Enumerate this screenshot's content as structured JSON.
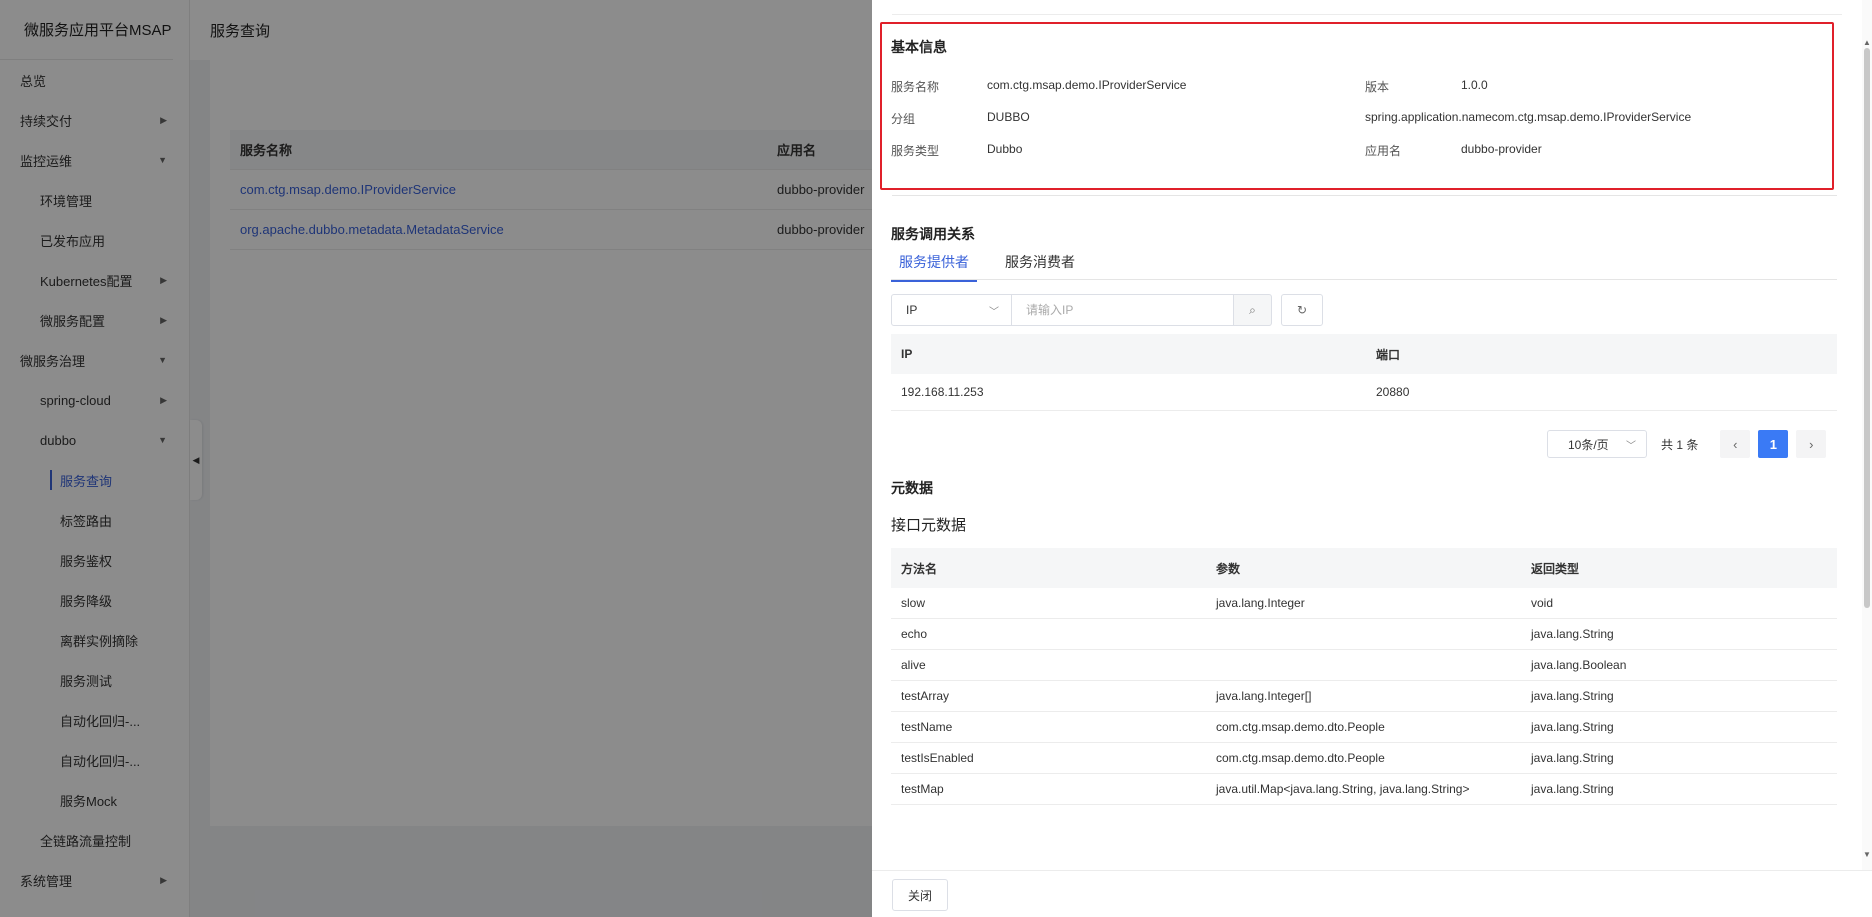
{
  "sidebar": {
    "title": "微服务应用平台MSAP",
    "items": [
      {
        "label": "总览",
        "level": 1,
        "arrow": ""
      },
      {
        "label": "持续交付",
        "level": 1,
        "arrow": "▶"
      },
      {
        "label": "监控运维",
        "level": 1,
        "arrow": "▼"
      },
      {
        "label": "环境管理",
        "level": 2,
        "arrow": ""
      },
      {
        "label": "已发布应用",
        "level": 2,
        "arrow": ""
      },
      {
        "label": "Kubernetes配置",
        "level": 2,
        "arrow": "▶"
      },
      {
        "label": "微服务配置",
        "level": 2,
        "arrow": "▶"
      },
      {
        "label": "微服务治理",
        "level": 1,
        "arrow": "▼"
      },
      {
        "label": "spring-cloud",
        "level": 2,
        "arrow": "▶"
      },
      {
        "label": "dubbo",
        "level": 2,
        "arrow": "▼"
      },
      {
        "label": "服务查询",
        "level": 3,
        "arrow": "",
        "active": true
      },
      {
        "label": "标签路由",
        "level": 3,
        "arrow": ""
      },
      {
        "label": "服务鉴权",
        "level": 3,
        "arrow": ""
      },
      {
        "label": "服务降级",
        "level": 3,
        "arrow": ""
      },
      {
        "label": "离群实例摘除",
        "level": 3,
        "arrow": ""
      },
      {
        "label": "服务测试",
        "level": 3,
        "arrow": ""
      },
      {
        "label": "自动化回归-...",
        "level": 3,
        "arrow": ""
      },
      {
        "label": "自动化回归-...",
        "level": 3,
        "arrow": ""
      },
      {
        "label": "服务Mock",
        "level": 3,
        "arrow": ""
      },
      {
        "label": "全链路流量控制",
        "level": 2,
        "arrow": ""
      },
      {
        "label": "系统管理",
        "level": 1,
        "arrow": "▶"
      }
    ]
  },
  "header": {
    "title": "服务查询"
  },
  "service_table": {
    "columns": [
      "服务名称",
      "应用名"
    ],
    "rows": [
      {
        "service": "com.ctg.msap.demo.IProviderService",
        "app": "dubbo-provider"
      },
      {
        "service": "org.apache.dubbo.metadata.MetadataService",
        "app": "dubbo-provider"
      }
    ]
  },
  "drawer": {
    "basic": {
      "title": "基本信息",
      "service_name_label": "服务名称",
      "service_name": "com.ctg.msap.demo.IProviderService",
      "version_label": "版本",
      "version": "1.0.0",
      "group_label": "分组",
      "group": "DUBBO",
      "spring_app_name": "spring.application.namecom.ctg.msap.demo.IProviderService",
      "service_type_label": "服务类型",
      "service_type": "Dubbo",
      "app_name_label": "应用名",
      "app_name": "dubbo-provider"
    },
    "relations": {
      "title": "服务调用关系",
      "tabs": [
        "服务提供者",
        "服务消费者"
      ],
      "search_field": "IP",
      "search_placeholder": "请输入IP",
      "columns": [
        "IP",
        "端口"
      ],
      "rows": [
        {
          "ip": "192.168.11.253",
          "port": "20880"
        }
      ],
      "page_size": "10条/页",
      "total": "共 1 条",
      "current_page": "1"
    },
    "metadata": {
      "title": "元数据",
      "subtitle": "接口元数据",
      "columns": [
        "方法名",
        "参数",
        "返回类型"
      ],
      "rows": [
        {
          "method": "slow",
          "params": "java.lang.Integer",
          "ret": "void"
        },
        {
          "method": "echo",
          "params": "",
          "ret": "java.lang.String"
        },
        {
          "method": "alive",
          "params": "",
          "ret": "java.lang.Boolean"
        },
        {
          "method": "testArray",
          "params": "java.lang.Integer[]",
          "ret": "java.lang.String"
        },
        {
          "method": "testName",
          "params": "com.ctg.msap.demo.dto.People",
          "ret": "java.lang.String"
        },
        {
          "method": "testIsEnabled",
          "params": "com.ctg.msap.demo.dto.People",
          "ret": "java.lang.String"
        },
        {
          "method": "testMap",
          "params": "java.util.Map<java.lang.String, java.lang.String>",
          "ret": "java.lang.String"
        }
      ]
    },
    "close_label": "关闭"
  },
  "icons": {
    "search": "search-icon",
    "refresh": "refresh-icon",
    "prev": "chevron-left-icon",
    "next": "chevron-right-icon",
    "collapse": "collapse-left-icon"
  },
  "colors": {
    "accent": "#3a62d9",
    "highlight_border": "#e0202a",
    "page_btn": "#3a7af5"
  }
}
